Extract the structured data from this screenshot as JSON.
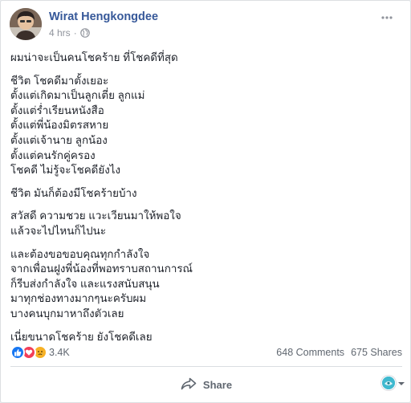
{
  "post": {
    "author": "Wirat Hengkongdee",
    "time": "4 hrs",
    "time_separator": "·",
    "paragraphs": [
      [
        "ผมน่าจะเป็นคนโชคร้าย ที่โชคดีที่สุด"
      ],
      [
        "ชีวิต โชคดีมาตั้งเยอะ",
        "ตั้งแต่เกิดมาเป็นลูกเตี่ย ลูกแม่",
        "ตั้งแต่ร่ำเรียนหนังสือ",
        "ตั้งแต่พี่น้องมิตรสหาย",
        "ตั้งแต่เจ้านาย ลูกน้อง",
        "ตั้งแต่คนรักคู่ครอง",
        "โชคดี ไม่รู้จะโชคดียังไง"
      ],
      [
        "ชีวิต มันก็ต้องมีโชคร้ายบ้าง"
      ],
      [
        "สวัสดี ความชวย แวะเวียนมาให้พอใจ",
        "แล้วจะไปไหนก็ไปนะ"
      ],
      [
        "และต้องขอขอบคุณทุกกำลังใจ",
        "จากเพื่อนฝูงพี่น้องที่พอทราบสถานการณ์",
        "ก็รีบส่งกำลังใจ และแรงสนับสนุน",
        "มาทุกช่องทางมากๆนะครับผม",
        "บางคนบุกมาหาถึงตัวเลย"
      ],
      [
        "เนี่ยขนาดโชคร้าย ยังโชคดีเลย"
      ]
    ]
  },
  "stats": {
    "reactions_count": "3.4K",
    "comments": "648 Comments",
    "shares": "675 Shares"
  },
  "actions": {
    "share_label": "Share"
  },
  "icons": {
    "more": "more-horizontal-icon",
    "globe": "globe-icon",
    "like": "like-icon",
    "love": "love-icon",
    "sad": "sad-icon",
    "share": "share-arrow-icon"
  },
  "colors": {
    "author": "#365899",
    "meta": "#90949c",
    "like": "#1877f2",
    "love": "#f33e58",
    "sad": "#f7b125"
  }
}
